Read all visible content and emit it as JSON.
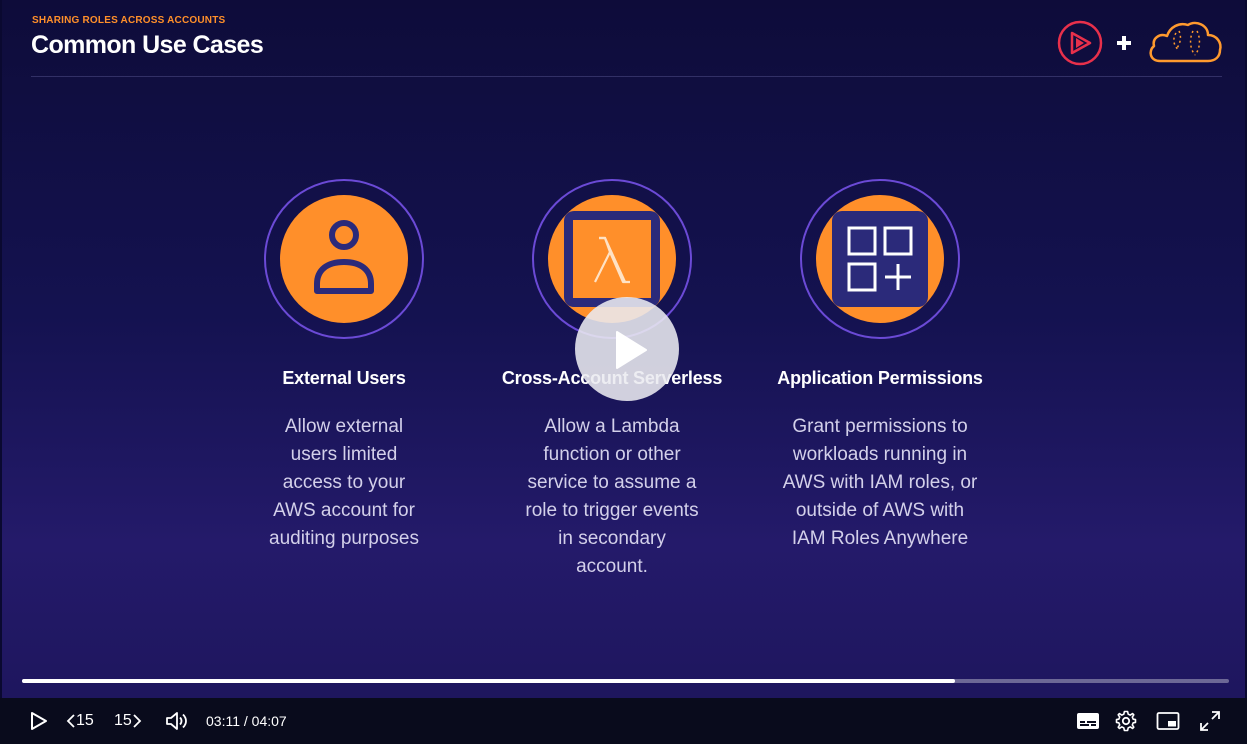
{
  "slide": {
    "section_label": "SHARING ROLES ACROSS ACCOUNTS",
    "title": "Common Use Cases",
    "cards": [
      {
        "icon": "user-icon",
        "title": "External Users",
        "description_lines": [
          "Allow external",
          "users limited",
          "access to your",
          "AWS account for",
          "auditing purposes"
        ]
      },
      {
        "icon": "lambda-icon",
        "title": "Cross-Account Serverless",
        "description_lines": [
          "Allow a Lambda",
          "function or other",
          "service to assume a",
          "role to trigger events",
          "in secondary",
          "account."
        ]
      },
      {
        "icon": "applications-grid-icon",
        "title": "Application Permissions",
        "description_lines": [
          "Grant permissions to",
          "workloads running in",
          "AWS with IAM roles, or",
          "outside of AWS with",
          "IAM Roles Anywhere"
        ]
      }
    ]
  },
  "player": {
    "current_time": "03:11",
    "duration": "04:07",
    "time_separator": " / ",
    "progress_fraction": 0.773,
    "skip_back_label": "15",
    "skip_forward_label": "15"
  },
  "colors": {
    "accent_orange": "#ff8f2a",
    "icon_navy": "#2b2a7a",
    "ring_purple": "#6b4ad6",
    "logo_red": "#e8304b"
  }
}
